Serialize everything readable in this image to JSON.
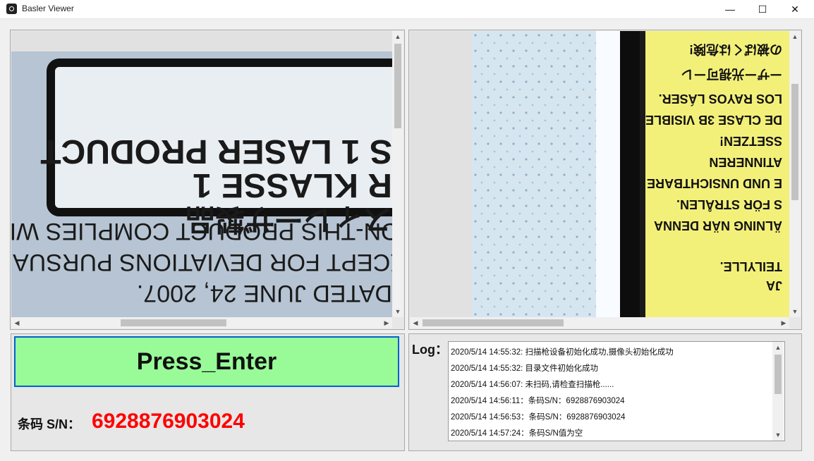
{
  "window": {
    "title": "Basler Viewer",
    "minimize_icon": "—",
    "maximize_icon": "☐",
    "close_icon": "✕"
  },
  "camera_left": {
    "label_lines": [
      "S 1 LASER PRODUCT",
      "R KLASSE 1",
      "スィレーザ製品"
    ],
    "body_lines": [
      "DATED JUNE 24, 2007.",
      "XCEPT FOR DEVIATIONS PURSUANT",
      "ION-THIS PRODUCT COMPLIES WI"
    ]
  },
  "camera_right": {
    "label_lines": [
      "の被ばくは危険!",
      "ーザー光視可ーレ",
      "LOS RAYOS LÁSER.",
      "DE CLASE 3B VISIBLE",
      "SSETZEN!",
      "ATINNEREN",
      "E UND UNSICHTBARE",
      "S FÖR STRÅLEN.",
      "ÄLNING NÄR DENNA",
      "TEILYLLE.",
      "JA"
    ]
  },
  "action": {
    "button_label": "Press_Enter"
  },
  "barcode": {
    "label": "条码 S/N：",
    "value": "6928876903024"
  },
  "log": {
    "label": "Log：",
    "entries": [
      "2020/5/14 14:55:32: 扫描枪设备初始化成功,摄像头初始化成功",
      "2020/5/14 14:55:32: 目录文件初始化成功",
      "2020/5/14 14:56:07: 未扫码,请检查扫描枪......",
      "2020/5/14 14:56:11：条码S/N：6928876903024",
      "2020/5/14 14:56:53：条码S/N：6928876903024",
      "2020/5/14 14:57:24：条码S/N值为空"
    ]
  },
  "colors": {
    "button_bg": "#98fb98",
    "button_border": "#0060d0",
    "sn_value": "#ff0000",
    "label_yellow": "#f3f07a"
  }
}
